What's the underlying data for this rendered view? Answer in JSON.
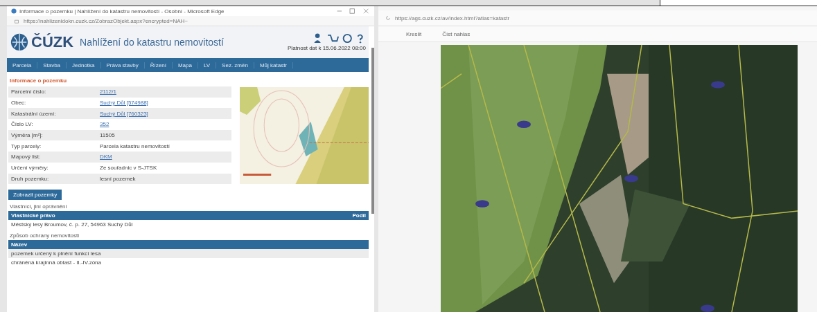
{
  "left_window": {
    "title": "Informace o pozemku | Nahlížení do katastru nemovitostí - Osobní - Microsoft Edge",
    "url": "https://nahlizenidokn.cuzk.cz/ZobrazObjekt.aspx?encrypted=NAH~",
    "logo": "ČÚZK",
    "site_title": "Nahlížení do katastru nemovitostí",
    "data_validity": "Platnost dat k 15.06.2022 08:00",
    "menu": [
      {
        "label": "Parcela",
        "selected": false
      },
      {
        "label": "Stavba",
        "selected": false
      },
      {
        "label": "Jednotka",
        "selected": false
      },
      {
        "label": "Práva stavby",
        "selected": false
      },
      {
        "label": "Řízení",
        "selected": false
      },
      {
        "label": "Mapa",
        "selected": false
      },
      {
        "label": "LV",
        "selected": false
      },
      {
        "label": "Sez. změn",
        "selected": false
      },
      {
        "label": "Můj katastr",
        "selected": false
      }
    ],
    "section_title": "Informace o pozemku",
    "info_rows": [
      {
        "label": "Parcelní číslo:",
        "value": "2112/1",
        "link": true
      },
      {
        "label": "Obec:",
        "value": "Suchý Důl [574988]",
        "link": true
      },
      {
        "label": "Katastrální území:",
        "value": "Suchý Důl [760323]",
        "link": true
      },
      {
        "label": "Číslo LV:",
        "value": "352",
        "link": true
      },
      {
        "label": "Výměra [m²]:",
        "value": "11505",
        "link": false
      },
      {
        "label": "Typ parcely:",
        "value": "Parcela katastru nemovitostí",
        "link": false
      },
      {
        "label": "Mapový list:",
        "value": "DKM",
        "link": true
      },
      {
        "label": "Určení výměry:",
        "value": "Ze souřadnic v S-JTSK",
        "link": false
      },
      {
        "label": "Druh pozemku:",
        "value": "lesní pozemek",
        "link": false
      }
    ],
    "map_button": "Zobrazit pozemky",
    "owners": {
      "title": "Vlastníci, jiní oprávnění",
      "columns": [
        "Vlastnické právo",
        "Podíl"
      ],
      "rows": [
        "Městský lesy Broumov, č. p. 27, 54963 Suchý Důl"
      ]
    },
    "protection": {
      "title": "Způsob ochrany nemovitosti",
      "columns": [
        "Název"
      ],
      "rows": [
        "pozemek určený k plnění funkcí lesa",
        "chráněná krajinná oblast - II.-IV.zóna"
      ]
    }
  },
  "right_window": {
    "url": "https://ags.cuzk.cz/av/index.html?atlas=katastr",
    "toolbar": [
      "Kreslit",
      "Číst nahlas"
    ]
  }
}
